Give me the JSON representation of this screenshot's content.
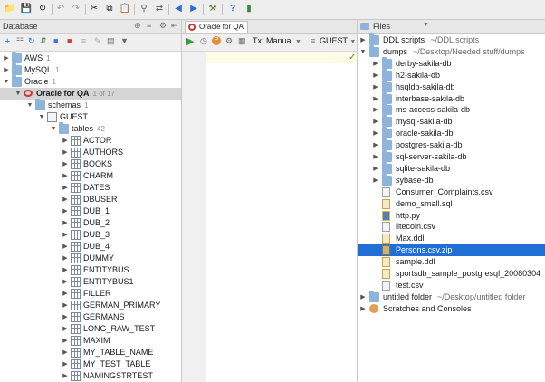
{
  "toolbar": {
    "icons": [
      "open-folder-icon",
      "save-icon",
      "refresh-icon",
      "undo-icon",
      "redo-icon",
      "cut-icon",
      "copy-icon",
      "paste-icon",
      "find-icon",
      "replace-icon",
      "back-icon",
      "forward-icon",
      "build-icon",
      "help-icon",
      "plugin-icon"
    ]
  },
  "database": {
    "title": "Database",
    "tree": [
      {
        "label": "AWS",
        "count": "1",
        "level": 0,
        "kind": "folder",
        "arrow": "▶"
      },
      {
        "label": "MySQL",
        "count": "1",
        "level": 0,
        "kind": "folder",
        "arrow": "▶"
      },
      {
        "label": "Oracle",
        "count": "1",
        "level": 0,
        "kind": "folder",
        "arrow": "▼"
      },
      {
        "label": "Oracle for QA",
        "count": "1 of 17",
        "level": 1,
        "kind": "oracle",
        "arrow": "▼",
        "selected": true,
        "bold": true
      },
      {
        "label": "schemas",
        "count": "1",
        "level": 2,
        "kind": "folder",
        "arrow": "▼"
      },
      {
        "label": "GUEST",
        "count": "",
        "level": 3,
        "kind": "schema",
        "arrow": "▼"
      },
      {
        "label": "tables",
        "count": "42",
        "level": 4,
        "kind": "folder",
        "arrow": "▼"
      },
      {
        "label": "ACTOR",
        "count": "",
        "level": 5,
        "kind": "table",
        "arrow": "▶"
      },
      {
        "label": "AUTHORS",
        "count": "",
        "level": 5,
        "kind": "table",
        "arrow": "▶"
      },
      {
        "label": "BOOKS",
        "count": "",
        "level": 5,
        "kind": "table",
        "arrow": "▶"
      },
      {
        "label": "CHARM",
        "count": "",
        "level": 5,
        "kind": "table",
        "arrow": "▶"
      },
      {
        "label": "DATES",
        "count": "",
        "level": 5,
        "kind": "table",
        "arrow": "▶"
      },
      {
        "label": "DBUSER",
        "count": "",
        "level": 5,
        "kind": "table",
        "arrow": "▶"
      },
      {
        "label": "DUB_1",
        "count": "",
        "level": 5,
        "kind": "table",
        "arrow": "▶"
      },
      {
        "label": "DUB_2",
        "count": "",
        "level": 5,
        "kind": "table",
        "arrow": "▶"
      },
      {
        "label": "DUB_3",
        "count": "",
        "level": 5,
        "kind": "table",
        "arrow": "▶"
      },
      {
        "label": "DUB_4",
        "count": "",
        "level": 5,
        "kind": "table",
        "arrow": "▶"
      },
      {
        "label": "DUMMY",
        "count": "",
        "level": 5,
        "kind": "table",
        "arrow": "▶"
      },
      {
        "label": "ENTITYBUS",
        "count": "",
        "level": 5,
        "kind": "table",
        "arrow": "▶"
      },
      {
        "label": "ENTITYBUS1",
        "count": "",
        "level": 5,
        "kind": "table",
        "arrow": "▶"
      },
      {
        "label": "FILLER",
        "count": "",
        "level": 5,
        "kind": "table",
        "arrow": "▶"
      },
      {
        "label": "GERMAN_PRIMARY",
        "count": "",
        "level": 5,
        "kind": "table",
        "arrow": "▶"
      },
      {
        "label": "GERMANS",
        "count": "",
        "level": 5,
        "kind": "table",
        "arrow": "▶"
      },
      {
        "label": "LONG_RAW_TEST",
        "count": "",
        "level": 5,
        "kind": "table",
        "arrow": "▶"
      },
      {
        "label": "MAXIM",
        "count": "",
        "level": 5,
        "kind": "table",
        "arrow": "▶"
      },
      {
        "label": "MY_TABLE_NAME",
        "count": "",
        "level": 5,
        "kind": "table",
        "arrow": "▶"
      },
      {
        "label": "MY_TEST_TABLE",
        "count": "",
        "level": 5,
        "kind": "table",
        "arrow": "▶"
      },
      {
        "label": "NAMINGSTRTEST",
        "count": "",
        "level": 5,
        "kind": "table",
        "arrow": "▶"
      }
    ]
  },
  "editor": {
    "tab_label": "Oracle for QA",
    "tx_label": "Tx: Manual",
    "schema_label": "GUEST"
  },
  "files": {
    "title": "Files",
    "tree": [
      {
        "label": "DDL scripts",
        "path": "~/DDL scripts",
        "level": 0,
        "kind": "folder",
        "arrow": "▶"
      },
      {
        "label": "dumps",
        "path": "~/Desktop/Needed stuff/dumps",
        "level": 0,
        "kind": "folder",
        "arrow": "▼"
      },
      {
        "label": "derby-sakila-db",
        "path": "",
        "level": 1,
        "kind": "folder",
        "arrow": "▶"
      },
      {
        "label": "h2-sakila-db",
        "path": "",
        "level": 1,
        "kind": "folder",
        "arrow": "▶"
      },
      {
        "label": "hsqldb-sakila-db",
        "path": "",
        "level": 1,
        "kind": "folder",
        "arrow": "▶"
      },
      {
        "label": "interbase-sakila-db",
        "path": "",
        "level": 1,
        "kind": "folder",
        "arrow": "▶"
      },
      {
        "label": "ms-access-sakila-db",
        "path": "",
        "level": 1,
        "kind": "folder",
        "arrow": "▶"
      },
      {
        "label": "mysql-sakila-db",
        "path": "",
        "level": 1,
        "kind": "folder",
        "arrow": "▶"
      },
      {
        "label": "oracle-sakila-db",
        "path": "",
        "level": 1,
        "kind": "folder",
        "arrow": "▶"
      },
      {
        "label": "postgres-sakila-db",
        "path": "",
        "level": 1,
        "kind": "folder",
        "arrow": "▶"
      },
      {
        "label": "sql-server-sakila-db",
        "path": "",
        "level": 1,
        "kind": "folder",
        "arrow": "▶"
      },
      {
        "label": "sqlite-sakila-db",
        "path": "",
        "level": 1,
        "kind": "folder",
        "arrow": "▶"
      },
      {
        "label": "sybase-db",
        "path": "",
        "level": 1,
        "kind": "folder",
        "arrow": "▶"
      },
      {
        "label": "Consumer_Complaints.csv",
        "path": "",
        "level": 1,
        "kind": "file",
        "arrow": ""
      },
      {
        "label": "demo_small.sql",
        "path": "",
        "level": 1,
        "kind": "sql",
        "arrow": ""
      },
      {
        "label": "http.py",
        "path": "",
        "level": 1,
        "kind": "py",
        "arrow": ""
      },
      {
        "label": "litecoin.csv",
        "path": "",
        "level": 1,
        "kind": "file",
        "arrow": ""
      },
      {
        "label": "Max.ddl",
        "path": "",
        "level": 1,
        "kind": "sql",
        "arrow": ""
      },
      {
        "label": "Persons.csv.zip",
        "path": "",
        "level": 1,
        "kind": "zip",
        "arrow": "",
        "selected": true
      },
      {
        "label": "sample.ddl",
        "path": "",
        "level": 1,
        "kind": "sql",
        "arrow": ""
      },
      {
        "label": "sportsdb_sample_postgresql_20080304",
        "path": "",
        "level": 1,
        "kind": "sql",
        "arrow": ""
      },
      {
        "label": "test.csv",
        "path": "",
        "level": 1,
        "kind": "file",
        "arrow": ""
      },
      {
        "label": "untitled folder",
        "path": "~/Desktop/untitled folder",
        "level": 0,
        "kind": "folder",
        "arrow": "▶"
      },
      {
        "label": "Scratches and Consoles",
        "path": "",
        "level": 0,
        "kind": "scratch",
        "arrow": "▶"
      }
    ]
  }
}
